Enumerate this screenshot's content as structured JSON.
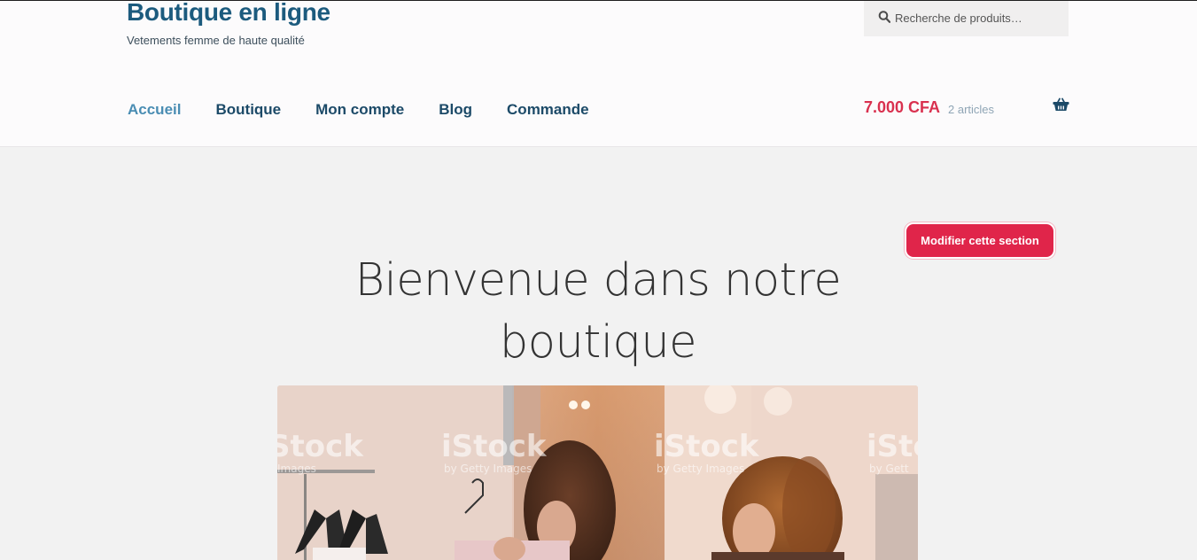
{
  "site": {
    "title": "Boutique en ligne",
    "tagline": "Vetements femme de haute qualité"
  },
  "search": {
    "placeholder": "Recherche de produits…",
    "icon": "search-icon"
  },
  "nav": {
    "items": [
      {
        "label": "Accueil",
        "active": true
      },
      {
        "label": "Boutique",
        "active": false
      },
      {
        "label": "Mon compte",
        "active": false
      },
      {
        "label": "Blog",
        "active": false
      },
      {
        "label": "Commande",
        "active": false
      }
    ]
  },
  "cart": {
    "total": "7.000 CFA",
    "count": "2 articles",
    "icon": "basket-icon"
  },
  "hero": {
    "edit_button": "Modifier cette section",
    "title": "Bienvenue dans notre boutique",
    "image_watermark": "iStock",
    "image_watermark_sub": "by Getty Images"
  },
  "colors": {
    "brand": "#1c5b7e",
    "nav_text": "#1c4a68",
    "nav_active": "#4a8db3",
    "accent": "#e0254a",
    "cart_total": "#d9314f",
    "header_bg": "#fcfbfc",
    "page_bg": "#f2f2f2"
  }
}
